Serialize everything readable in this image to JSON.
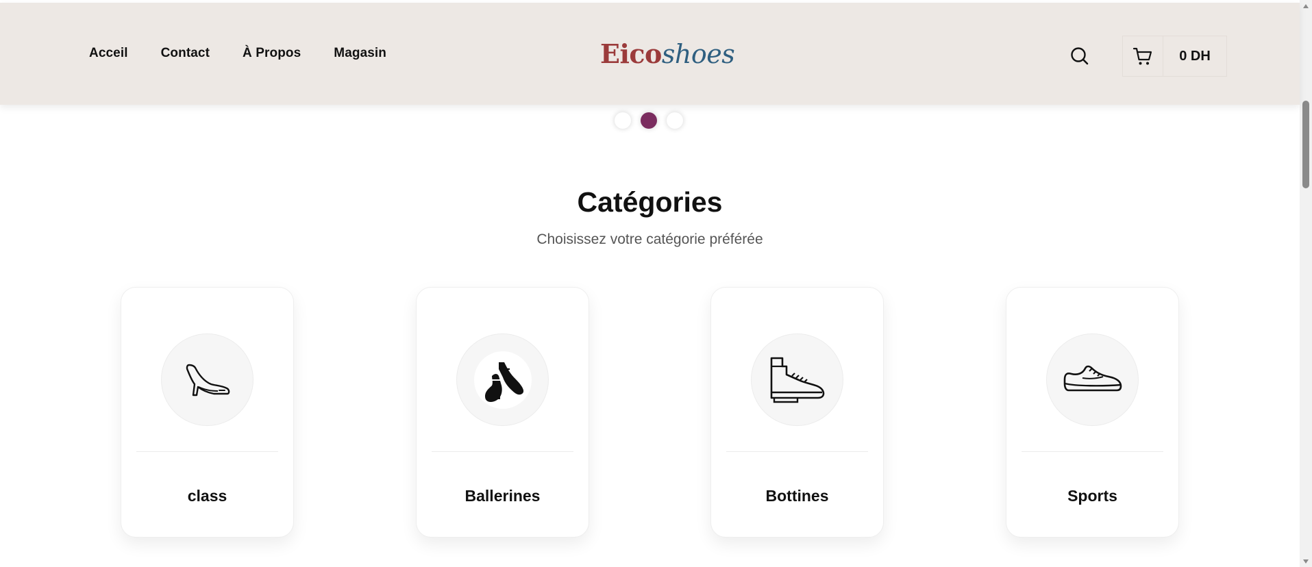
{
  "header": {
    "nav": [
      "Acceil",
      "Contact",
      "À Propos",
      "Magasin"
    ],
    "logo": {
      "part1": "Eico",
      "part2": "shoes"
    },
    "cart_total": "0 DH",
    "search_icon": "search-icon",
    "cart_icon": "cart-icon"
  },
  "carousel": {
    "dots": 3,
    "active_index": 1
  },
  "section": {
    "title": "Catégories",
    "subtitle": "Choisissez votre catégorie préférée"
  },
  "categories": [
    {
      "label": "class",
      "icon": "high-heel-icon"
    },
    {
      "label": "Ballerines",
      "icon": "ballerina-shoes-icon"
    },
    {
      "label": "Bottines",
      "icon": "boot-icon"
    },
    {
      "label": "Sports",
      "icon": "sneaker-icon"
    }
  ],
  "colors": {
    "header_bg": "#ede8e4",
    "logo_primary": "#9b3b3b",
    "logo_secondary": "#2f5f80",
    "dot_active": "#7b2d5f"
  }
}
